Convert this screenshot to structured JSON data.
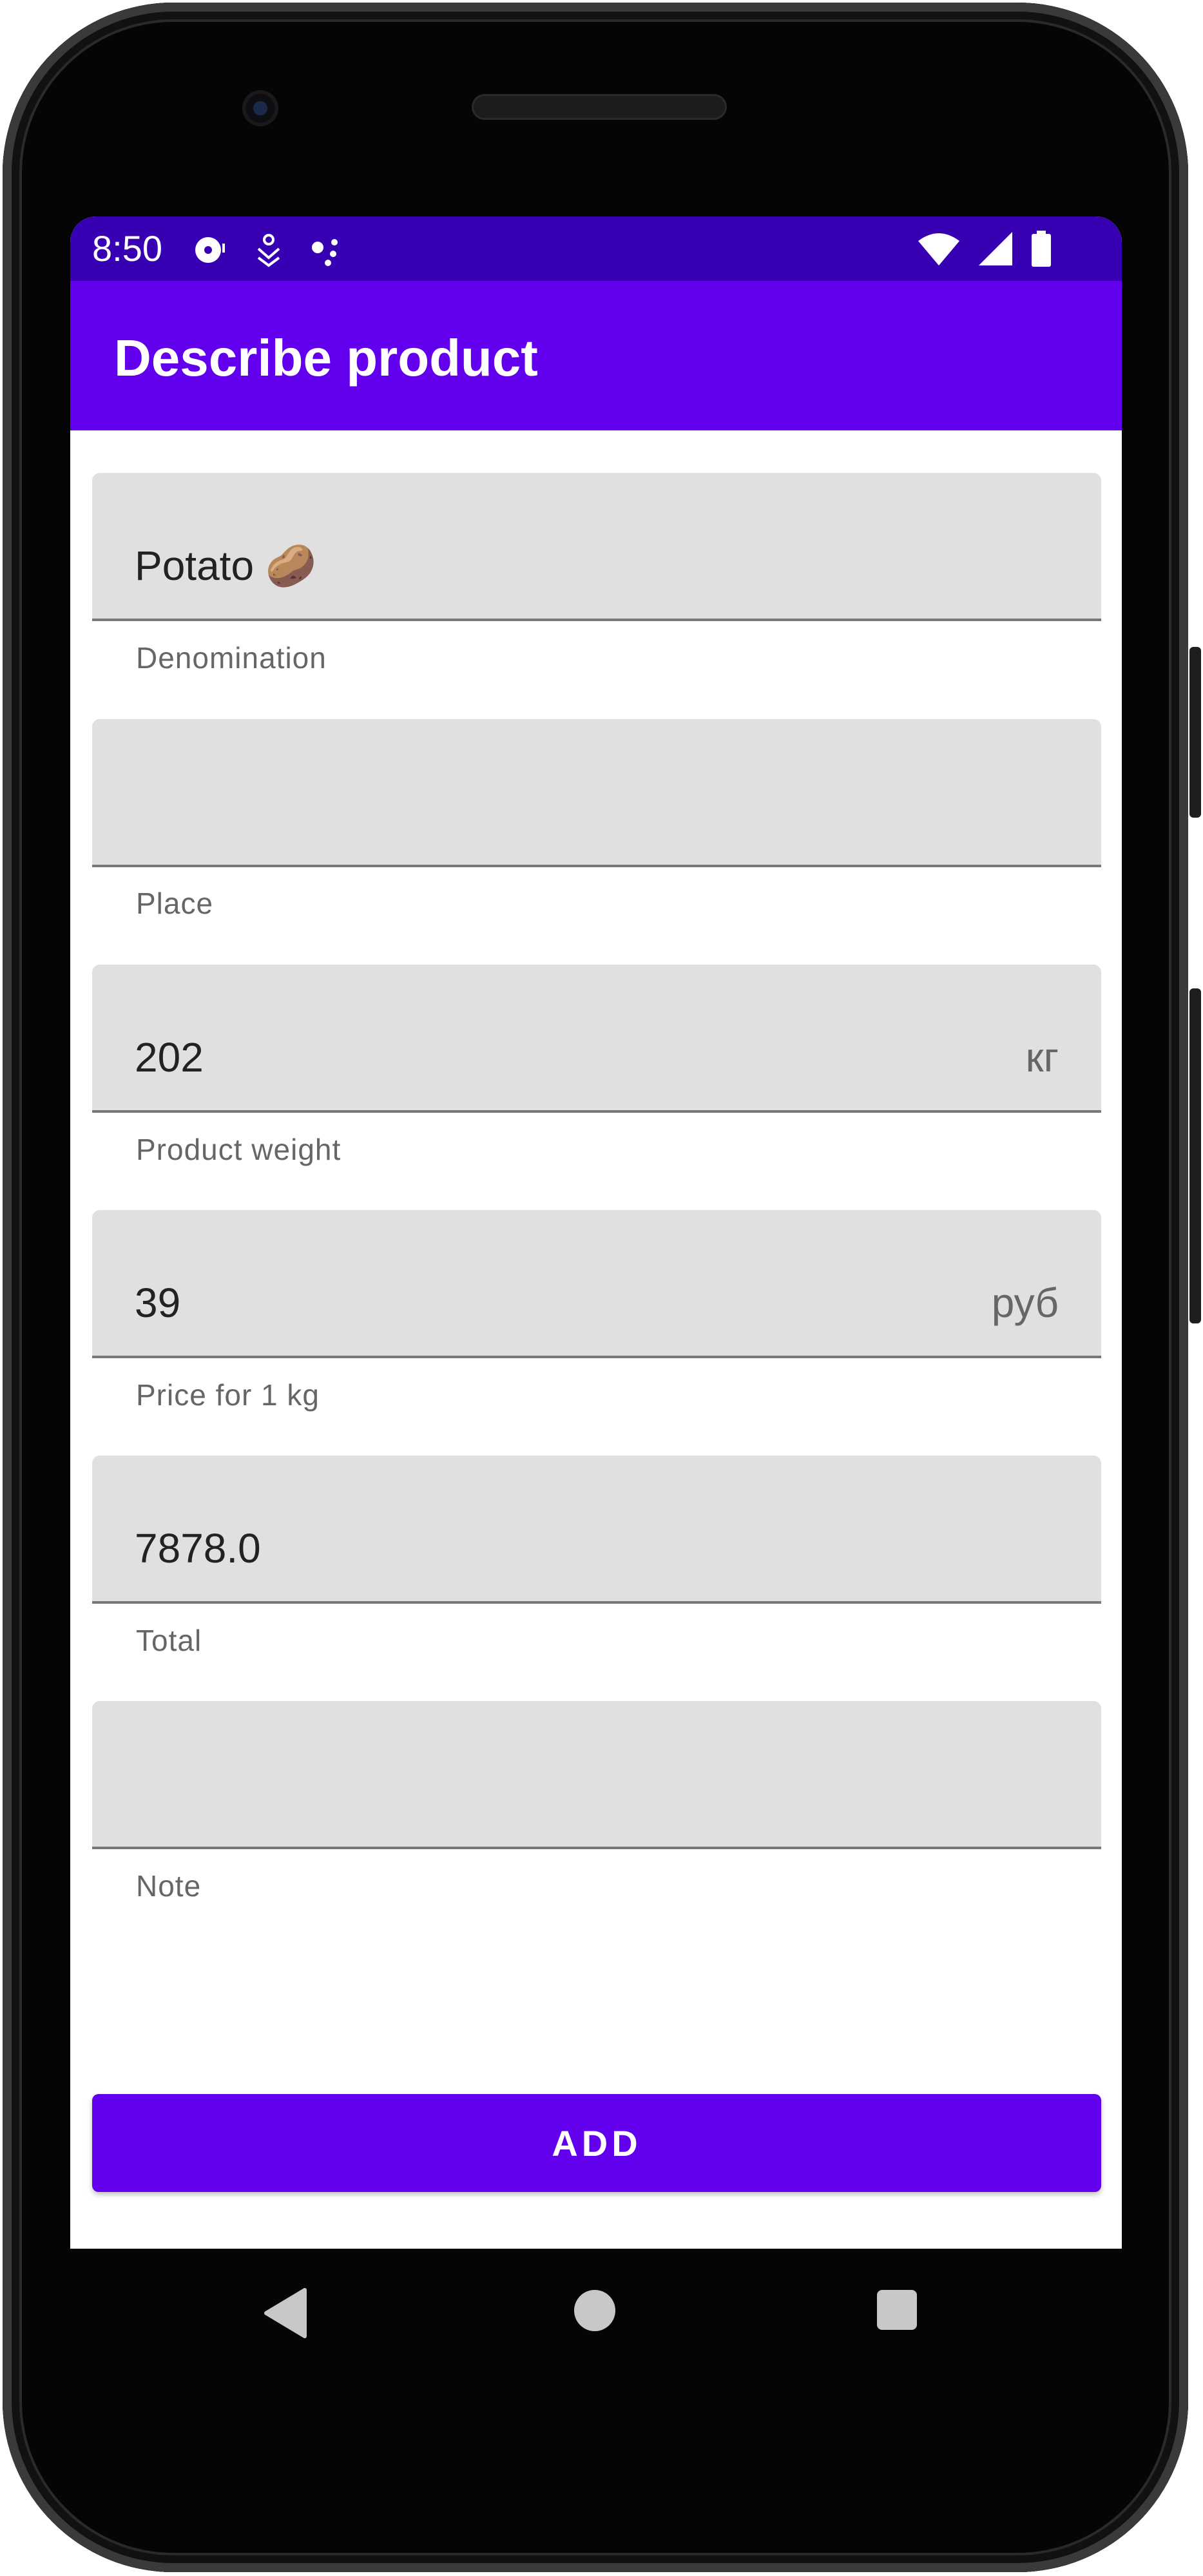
{
  "status_bar": {
    "time": "8:50",
    "left_icons": [
      "media-notification-icon",
      "accessibility-icon",
      "dots-notification-icon"
    ],
    "right_icons": [
      "wifi-icon",
      "cell-signal-icon",
      "battery-icon"
    ]
  },
  "app_bar": {
    "title": "Describe product"
  },
  "form": {
    "fields": [
      {
        "value": "Potato 🥔",
        "suffix": "",
        "helper": "Denomination"
      },
      {
        "value": "",
        "suffix": "",
        "helper": "Place"
      },
      {
        "value": "202",
        "suffix": "кг",
        "helper": "Product weight"
      },
      {
        "value": "39",
        "suffix": "руб",
        "helper": "Price for 1 kg"
      },
      {
        "value": "7878.0",
        "suffix": "",
        "helper": "Total"
      },
      {
        "value": "",
        "suffix": "",
        "helper": "Note"
      }
    ],
    "add_label": "ADD"
  },
  "nav_bar": {
    "icons": [
      "back-icon",
      "home-icon",
      "recents-icon"
    ]
  },
  "colors": {
    "primary": "#6200ee",
    "primary_dark": "#3700b3",
    "field_bg": "#e0e0e0",
    "helper_text": "#666666"
  }
}
